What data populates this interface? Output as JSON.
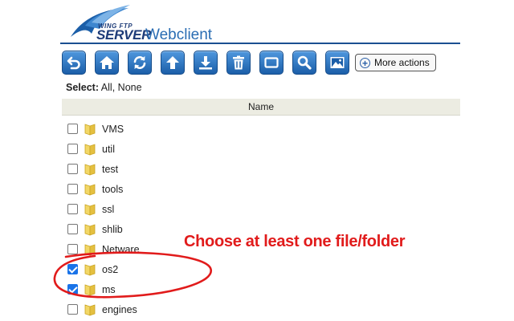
{
  "header": {
    "logo_top": "WING FTP",
    "logo_server": "SERVER",
    "webclient": "Webclient"
  },
  "toolbar": {
    "buttons": [
      {
        "icon": "back-icon"
      },
      {
        "icon": "home-icon"
      },
      {
        "icon": "refresh-icon"
      },
      {
        "icon": "upload-icon"
      },
      {
        "icon": "download-icon"
      },
      {
        "icon": "trash-icon"
      },
      {
        "icon": "folder-icon"
      },
      {
        "icon": "search-icon"
      },
      {
        "icon": "image-icon"
      }
    ],
    "more_actions": "More actions"
  },
  "select": {
    "label": "Select:",
    "all": "All",
    "none": "None"
  },
  "table": {
    "column_name": "Name"
  },
  "files": [
    {
      "name": "VMS",
      "checked": false
    },
    {
      "name": "util",
      "checked": false
    },
    {
      "name": "test",
      "checked": false
    },
    {
      "name": "tools",
      "checked": false
    },
    {
      "name": "ssl",
      "checked": false
    },
    {
      "name": "shlib",
      "checked": false
    },
    {
      "name": "Netware",
      "checked": false
    },
    {
      "name": "os2",
      "checked": true
    },
    {
      "name": "ms",
      "checked": true
    },
    {
      "name": "engines",
      "checked": false
    }
  ],
  "annotation": {
    "text": "Choose at least one file/folder",
    "color": "#e11b1b"
  },
  "colors": {
    "accent": "#1b5ea8",
    "header_rule": "#1b4f91",
    "folder": "#e9c84a"
  }
}
